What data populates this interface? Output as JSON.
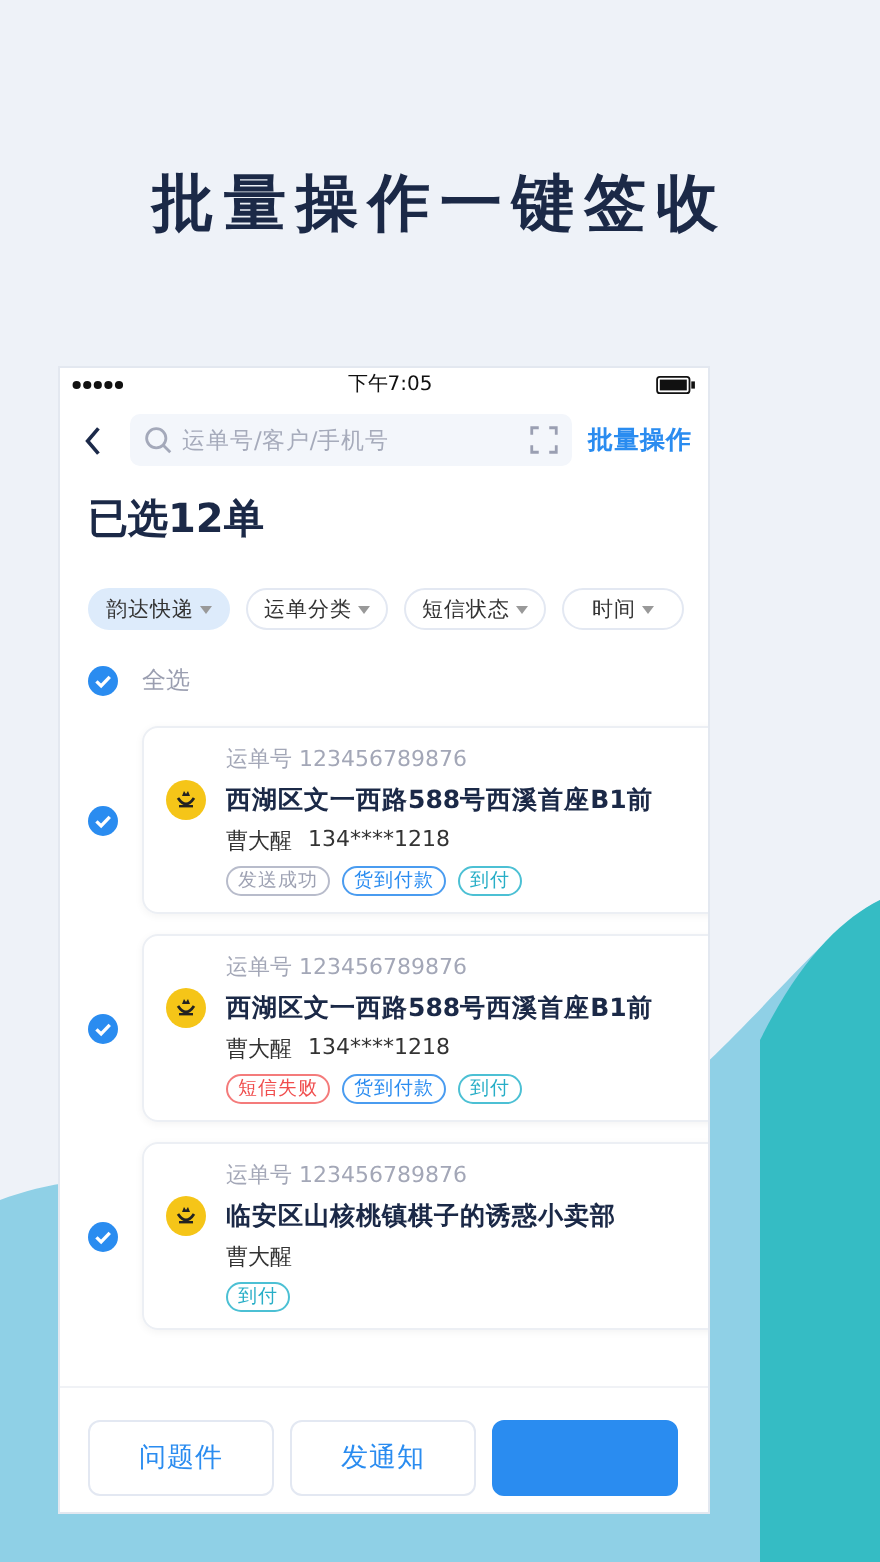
{
  "headline": "批量操作一键签收",
  "status_bar": {
    "time": "下午7:05"
  },
  "header": {
    "search_placeholder": "运单号/客户/手机号",
    "action": "批量操作"
  },
  "title": "已选12单",
  "filters": [
    {
      "label": "韵达快递",
      "selected": true
    },
    {
      "label": "运单分类",
      "selected": false
    },
    {
      "label": "短信状态",
      "selected": false
    },
    {
      "label": "时间",
      "selected": false
    }
  ],
  "select_all": {
    "label": "全选",
    "checked": true
  },
  "orders": [
    {
      "checked": true,
      "waybill": "运单号 123456789876",
      "address": "西湖区文一西路588号西溪首座B1前",
      "recipient": "曹大醒",
      "phone": "134****1218",
      "tags": [
        {
          "label": "发送成功",
          "kind": "neutral"
        },
        {
          "label": "货到付款",
          "kind": "blue"
        },
        {
          "label": "到付",
          "kind": "teal"
        }
      ]
    },
    {
      "checked": true,
      "waybill": "运单号 123456789876",
      "address": "西湖区文一西路588号西溪首座B1前",
      "recipient": "曹大醒",
      "phone": "134****1218",
      "tags": [
        {
          "label": "短信失败",
          "kind": "error"
        },
        {
          "label": "货到付款",
          "kind": "blue"
        },
        {
          "label": "到付",
          "kind": "teal"
        }
      ]
    },
    {
      "checked": true,
      "waybill": "运单号 123456789876",
      "address": "临安区山核桃镇棋子的诱惑小卖部",
      "recipient": "曹大醒",
      "tags": [
        {
          "label": "到付",
          "kind": "teal"
        }
      ]
    }
  ],
  "buttons": [
    {
      "label": "问题件",
      "kind": "outline"
    },
    {
      "label": "发通知",
      "kind": "outline"
    },
    {
      "kind": "primary"
    }
  ]
}
